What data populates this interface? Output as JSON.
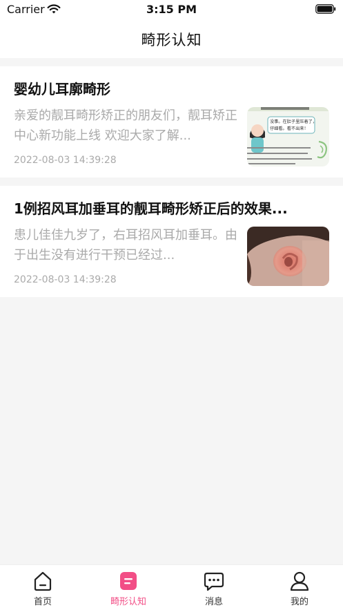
{
  "status": {
    "carrier": "Carrier",
    "time": "3:15 PM"
  },
  "nav": {
    "title": "畸形认知"
  },
  "articles": [
    {
      "title": "婴幼儿耳廓畸形",
      "summary": "亲爱的靓耳畸形矫正的朋友们，靓耳矫正中心新功能上线 欢迎大家了解...",
      "date": "2022-08-03 14:39:28"
    },
    {
      "title": "1例招风耳加垂耳的靓耳畸形矫正后的效果...",
      "summary": "患儿佳佳九岁了，右耳招风耳加垂耳。由于出生没有进行干预已经过...",
      "date": "2022-08-03 14:39:28"
    }
  ],
  "thumb1": {
    "text_top": "没事。在肚子里压着了，",
    "text_mid": "仔细看。看不出来！"
  },
  "tabs": [
    {
      "label": "首页"
    },
    {
      "label": "畸形认知"
    },
    {
      "label": "消息"
    },
    {
      "label": "我的"
    }
  ],
  "colors": {
    "accent": "#f24e86"
  }
}
